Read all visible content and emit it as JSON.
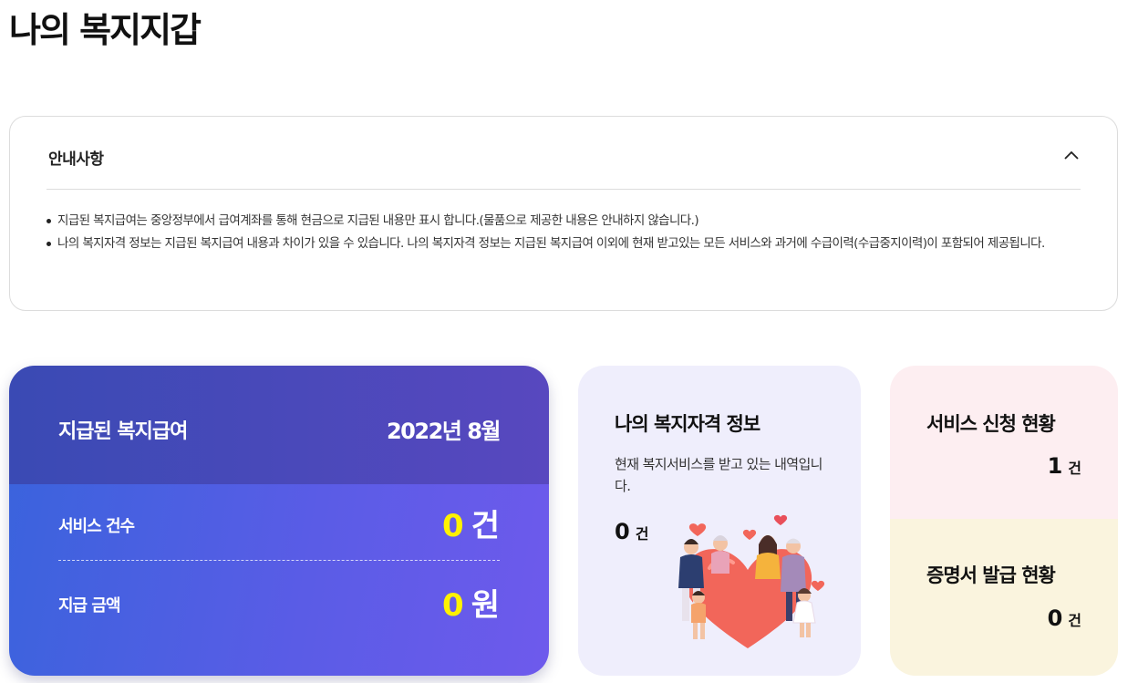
{
  "page": {
    "title": "나의 복지지갑"
  },
  "notice": {
    "title": "안내사항",
    "items": [
      "지급된 복지급여는 중앙정부에서 급여계좌를 통해 현금으로 지급된 내용만 표시 합니다.(물품으로 제공한 내용은 안내하지 않습니다.)",
      "나의 복지자격 정보는 지급된 복지급여 내용과 차이가 있을 수 있습니다. 나의 복지자격 정보는 지급된 복지급여 이외에 현재 받고있는 모든 서비스와 과거에 수급이력(수급중지이력)이 포함되어 제공됩니다."
    ]
  },
  "paid_card": {
    "title": "지급된 복지급여",
    "year": "2022년",
    "month": "8월",
    "rows": [
      {
        "label": "서비스 건수",
        "value": "0",
        "unit": "건"
      },
      {
        "label": "지급 금액",
        "value": "0",
        "unit": "원"
      }
    ]
  },
  "qualification_card": {
    "title": "나의 복지자격 정보",
    "description": "현재 복지서비스를 받고 있는 내역입니다.",
    "count": "0",
    "unit": "건"
  },
  "service_card": {
    "application": {
      "title": "서비스 신청 현황",
      "count": "1",
      "unit": "건"
    },
    "certificate": {
      "title": "증명서 발급 현황",
      "count": "0",
      "unit": "건"
    }
  },
  "colors": {
    "accent_yellow": "#fff200",
    "paid_gradient_start": "#3b63dd",
    "paid_gradient_end": "#6e5aec",
    "qual_bg": "#efeefc",
    "svc_top_bg": "#fdeef1",
    "svc_bottom_bg": "#faf4de"
  },
  "icons": {
    "notice_toggle": "chevron-up-icon",
    "illustration": "family-heart-illustration"
  }
}
